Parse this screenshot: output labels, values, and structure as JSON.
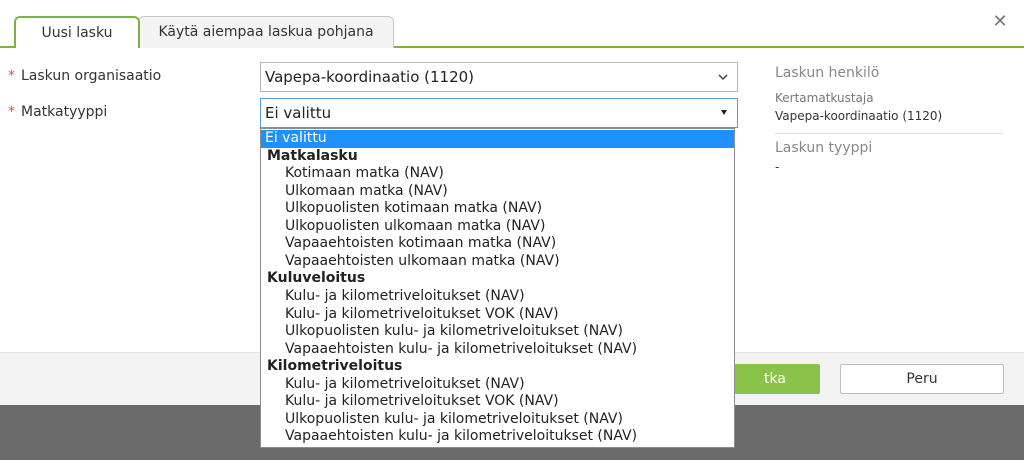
{
  "tabs": {
    "active": "Uusi lasku",
    "inactive": "Käytä aiempaa laskua pohjana"
  },
  "form": {
    "org_label": "Laskun organisaatio",
    "org_value": "Vapepa-koordinaatio (1120)",
    "trip_label": "Matkatyyppi",
    "trip_value": "Ei valittu",
    "required_mark": "*"
  },
  "side": {
    "person_title": "Laskun henkilö",
    "person_role": "Kertamatkustaja",
    "person_org": "Vapepa-koordinaatio (1120)",
    "type_title": "Laskun tyyppi",
    "type_value": "-"
  },
  "footer": {
    "primary_label": "tka",
    "cancel_label": "Peru"
  },
  "dropdown": {
    "options": [
      {
        "text": "Ei valittu",
        "kind": "selected"
      },
      {
        "text": "Matkalasku",
        "kind": "group"
      },
      {
        "text": "Kotimaan matka (NAV)",
        "kind": "item"
      },
      {
        "text": "Ulkomaan matka (NAV)",
        "kind": "item"
      },
      {
        "text": "Ulkopuolisten kotimaan matka (NAV)",
        "kind": "item"
      },
      {
        "text": "Ulkopuolisten ulkomaan matka (NAV)",
        "kind": "item"
      },
      {
        "text": "Vapaaehtoisten kotimaan matka (NAV)",
        "kind": "item"
      },
      {
        "text": "Vapaaehtoisten ulkomaan matka (NAV)",
        "kind": "item"
      },
      {
        "text": "Kuluveloitus",
        "kind": "group"
      },
      {
        "text": "Kulu- ja kilometriveloitukset (NAV)",
        "kind": "item"
      },
      {
        "text": "Kulu- ja kilometriveloitukset VOK (NAV)",
        "kind": "item"
      },
      {
        "text": "Ulkopuolisten kulu- ja kilometriveloitukset (NAV)",
        "kind": "item"
      },
      {
        "text": "Vapaaehtoisten kulu- ja kilometriveloitukset (NAV)",
        "kind": "item"
      },
      {
        "text": "Kilometriveloitus",
        "kind": "group"
      },
      {
        "text": "Kulu- ja kilometriveloitukset (NAV)",
        "kind": "item"
      },
      {
        "text": "Kulu- ja kilometriveloitukset VOK (NAV)",
        "kind": "item"
      },
      {
        "text": "Ulkopuolisten kulu- ja kilometriveloitukset (NAV)",
        "kind": "item"
      },
      {
        "text": "Vapaaehtoisten kulu- ja kilometriveloitukset (NAV)",
        "kind": "item"
      }
    ]
  },
  "icons": {
    "close": "close-icon",
    "chevron": "chevron-down-icon",
    "dropdown_arrow": "caret-down-icon"
  },
  "colors": {
    "accent": "#7cb342",
    "primary_button": "#8bc34a",
    "selected_option": "#1e90ff",
    "required": "#d9534f"
  }
}
